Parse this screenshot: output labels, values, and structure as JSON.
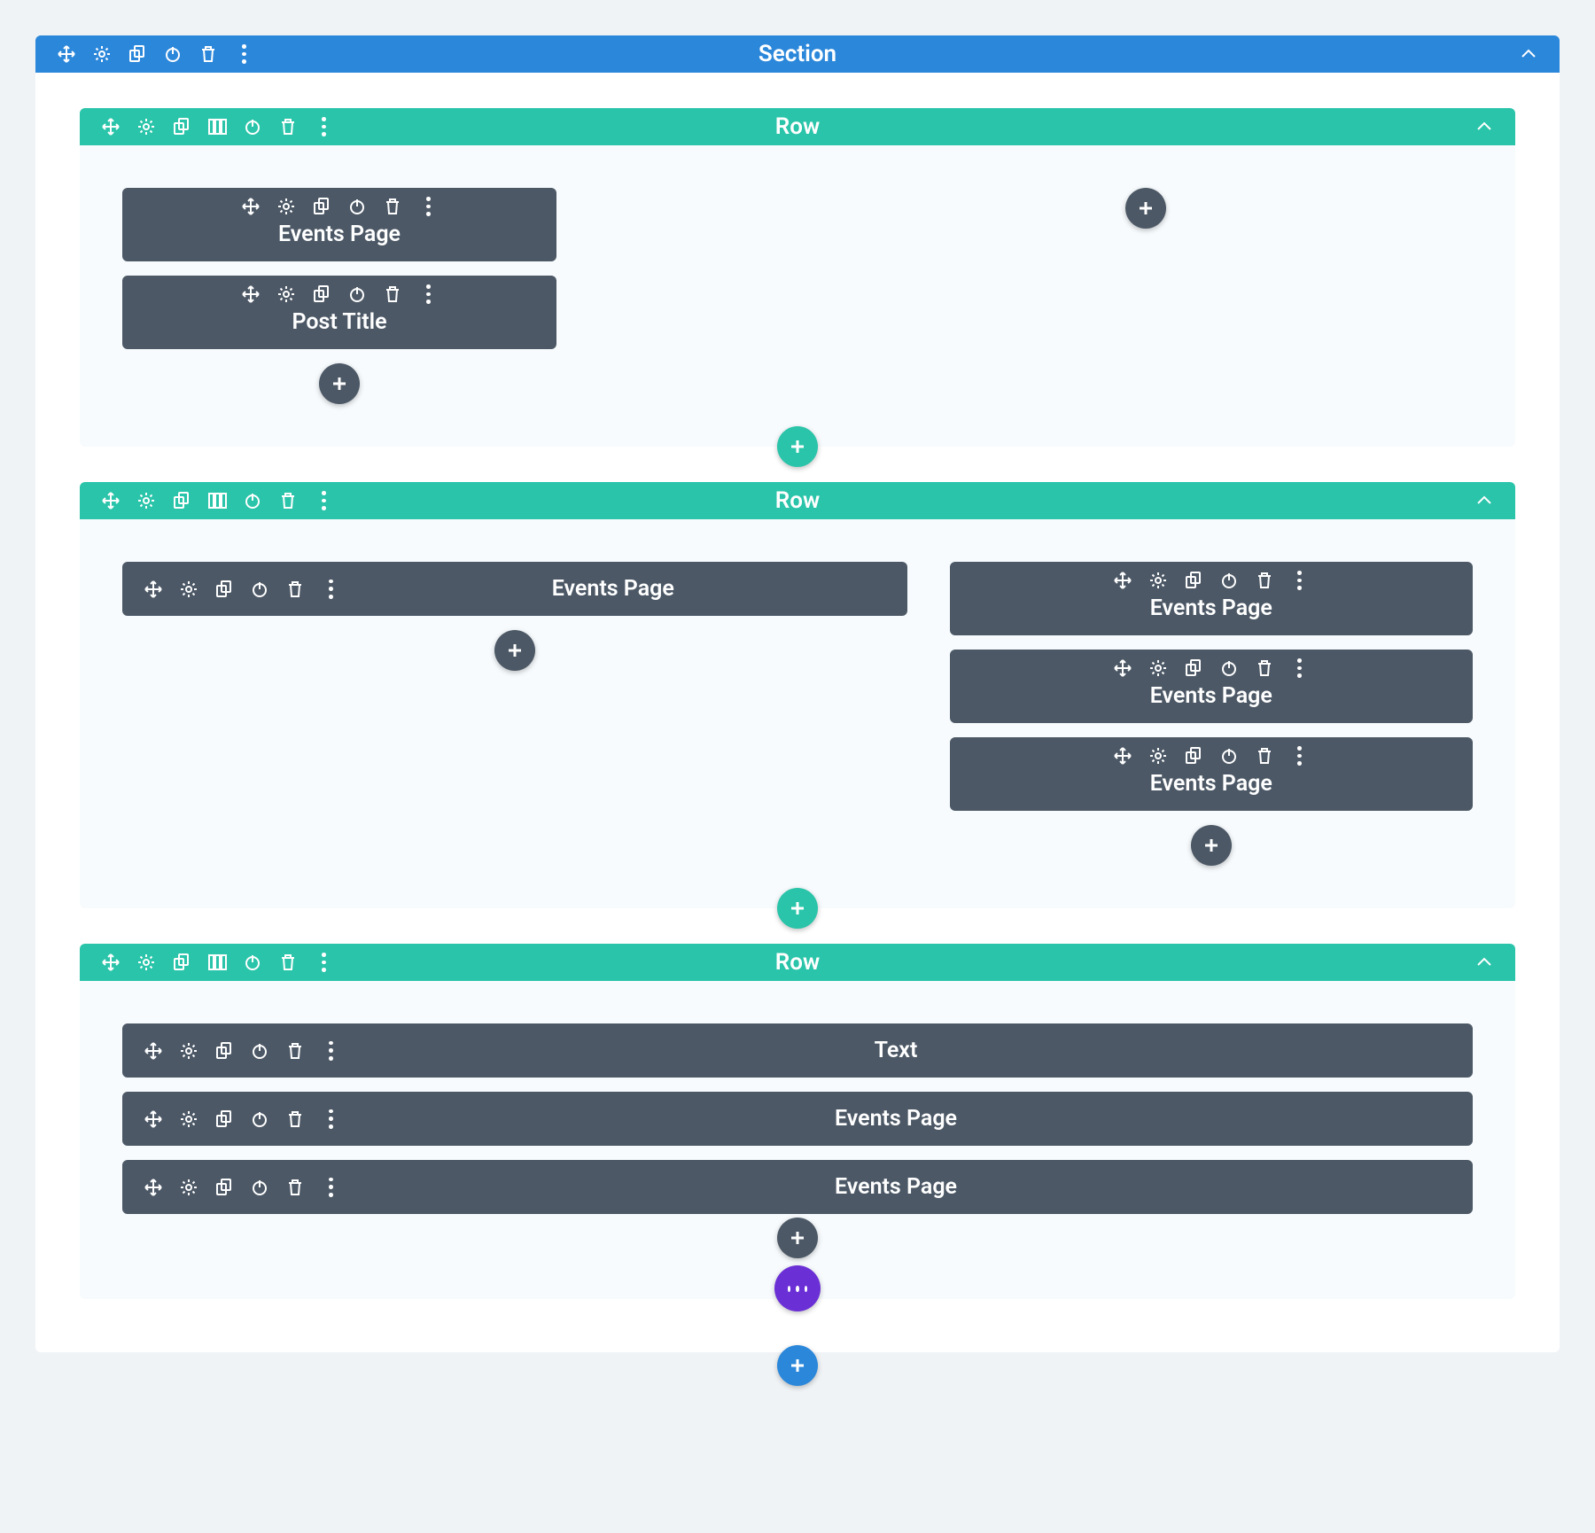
{
  "colors": {
    "blue": "#2b87da",
    "green": "#29c4a9",
    "module": "#4c5866",
    "purple": "#6b2fd6"
  },
  "section": {
    "title": "Section",
    "rows": [
      {
        "title": "Row",
        "layout": "two-col",
        "columns": [
          {
            "modules": [
              {
                "title": "Events Page"
              },
              {
                "title": "Post Title"
              }
            ]
          },
          {
            "modules": []
          }
        ]
      },
      {
        "title": "Row",
        "layout": "two-col-wide",
        "columns": [
          {
            "modules": [
              {
                "title": "Events Page"
              }
            ]
          },
          {
            "modules": [
              {
                "title": "Events Page"
              },
              {
                "title": "Events Page"
              },
              {
                "title": "Events Page"
              }
            ]
          }
        ]
      },
      {
        "title": "Row",
        "layout": "one-col",
        "columns": [
          {
            "modules": [
              {
                "title": "Text"
              },
              {
                "title": "Events Page"
              },
              {
                "title": "Events Page"
              }
            ]
          }
        ]
      }
    ]
  }
}
